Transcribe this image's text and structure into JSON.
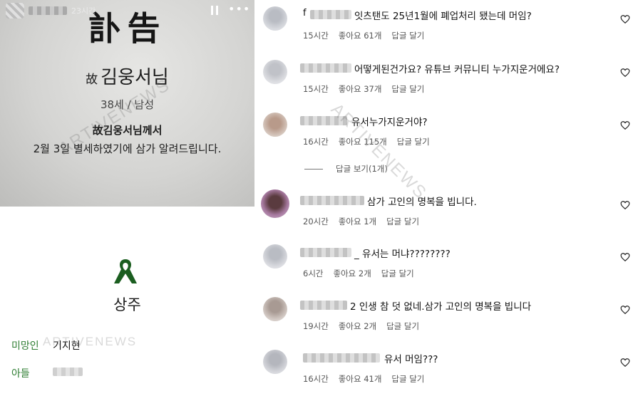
{
  "story": {
    "time": "23시간",
    "more_label": "•••",
    "notice": {
      "title": "訃告",
      "deceased_prefix": "故",
      "deceased_name": "김웅서님",
      "age_gender": "38세 / 남성",
      "line1": "故김웅서님께서",
      "line2": "2월 3일 별세하였기에 삼가 알려드립니다."
    },
    "chief_mourner_label": "상주",
    "family": [
      {
        "relation": "미망인",
        "name": "기지현"
      },
      {
        "relation": "아들",
        "name": ""
      }
    ]
  },
  "watermark": "ARTIVENEWS",
  "comments": [
    {
      "prefix": "f",
      "text": "잇츠탠도 25년1월에 폐업처리 됐는데 머임?",
      "time": "15시간",
      "likes": "좋아요 61개",
      "reply": "답글 달기"
    },
    {
      "prefix": "",
      "text": "어떻게된건가요? 유튜브 커뮤니티 누가지운거에요?",
      "time": "15시간",
      "likes": "좋아요 37개",
      "reply": "답글 달기"
    },
    {
      "prefix": "",
      "text": "유서누가지운거야?",
      "time": "16시간",
      "likes": "좋아요 115개",
      "reply": "답글 달기"
    },
    {
      "prefix": "",
      "text": "삼가 고인의 명복을 빕니다.",
      "time": "20시간",
      "likes": "좋아요 1개",
      "reply": "답글 달기"
    },
    {
      "prefix": "",
      "text": "_ 유서는 머냐????????",
      "time": "6시간",
      "likes": "좋아요 2개",
      "reply": "답글 달기"
    },
    {
      "prefix": "",
      "text": "2 인생 참 덧 없네.삼가 고인의 명복을 빕니다",
      "time": "19시간",
      "likes": "좋아요 2개",
      "reply": "답글 달기"
    },
    {
      "prefix": "",
      "text": "유서 머임???",
      "time": "16시간",
      "likes": "좋아요 41개",
      "reply": "답글 달기"
    }
  ],
  "view_replies": "답글 보기(1개)",
  "colors": {
    "family_label": "#2e7d32",
    "ribbon": "#1b5e20"
  }
}
